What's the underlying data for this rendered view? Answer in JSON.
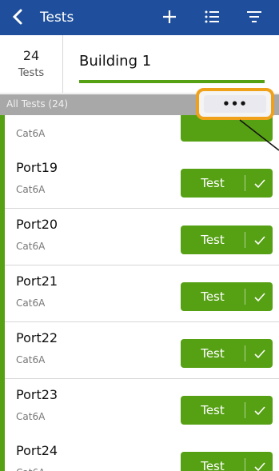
{
  "topbar": {
    "title": "Tests"
  },
  "header": {
    "count": "24",
    "count_label": "Tests",
    "building": "Building 1"
  },
  "filter": {
    "label": "All Tests (24)",
    "more": "•••"
  },
  "partial_row": {
    "type": "Cat6A"
  },
  "rows": [
    {
      "name": "Port19",
      "type": "Cat6A",
      "button": "Test"
    },
    {
      "name": "Port20",
      "type": "Cat6A",
      "button": "Test"
    },
    {
      "name": "Port21",
      "type": "Cat6A",
      "button": "Test"
    },
    {
      "name": "Port22",
      "type": "Cat6A",
      "button": "Test"
    },
    {
      "name": "Port23",
      "type": "Cat6A",
      "button": "Test"
    },
    {
      "name": "Port24",
      "type": "Cat6A",
      "button": "Test"
    }
  ],
  "colors": {
    "accent_green": "#56a014",
    "topbar_blue": "#1f4f9c",
    "highlight_orange": "#f0a11a"
  }
}
